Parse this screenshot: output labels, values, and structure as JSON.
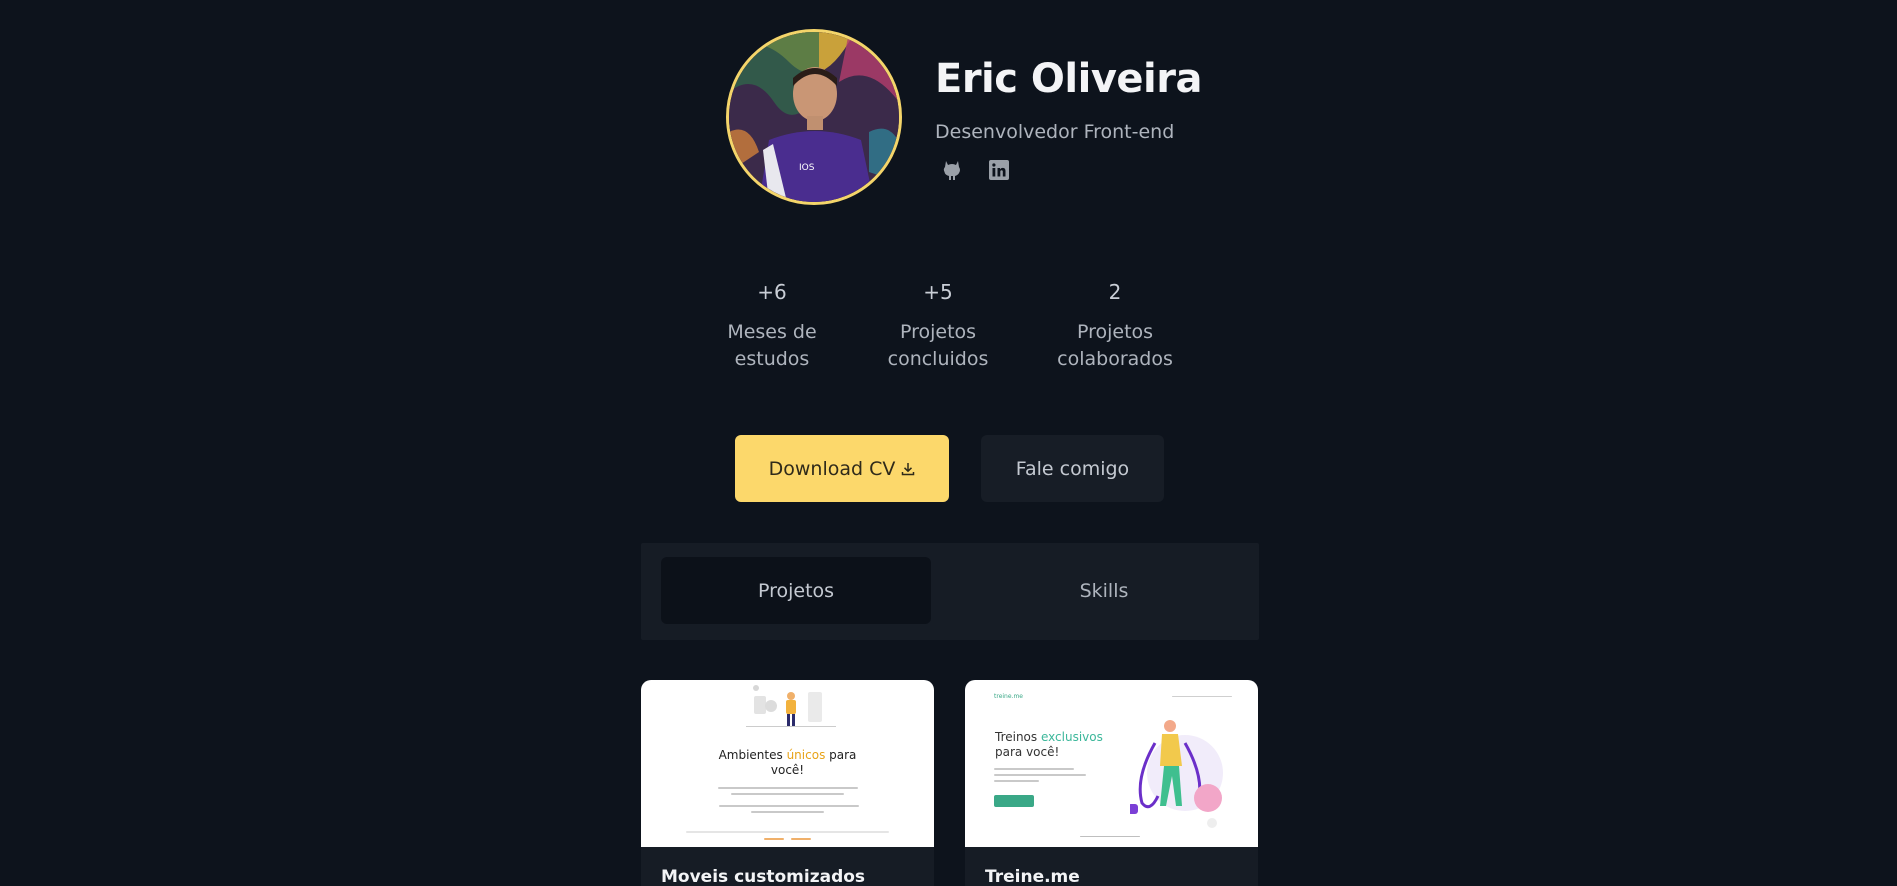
{
  "profile": {
    "name": "Eric Oliveira",
    "role": "Desenvolvedor Front-end",
    "socials": [
      {
        "icon": "github-icon"
      },
      {
        "icon": "linkedin-icon"
      }
    ]
  },
  "stats": [
    {
      "value": "+6",
      "label": "Meses de\nestudos"
    },
    {
      "value": "+5",
      "label": "Projetos\nconcluidos"
    },
    {
      "value": "2",
      "label": "Projetos\ncolaborados"
    }
  ],
  "actions": {
    "download_label": "Download CV",
    "contact_label": "Fale comigo"
  },
  "tabs": [
    {
      "label": "Projetos",
      "active": true
    },
    {
      "label": "Skills",
      "active": false
    }
  ],
  "projects": [
    {
      "title": "Moveis customizados",
      "headline_pre": "Ambientes ",
      "headline_highlight": "únicos",
      "headline_post": " para",
      "headline_line2": "você!"
    },
    {
      "title": "Treine.me",
      "logo": "treine.me",
      "headline_pre": "Treinos ",
      "headline_highlight": "exclusivos",
      "headline_line2": "para você!"
    }
  ],
  "colors": {
    "background": "#0d131c",
    "accent": "#fcd86b",
    "panel": "#161c25"
  }
}
